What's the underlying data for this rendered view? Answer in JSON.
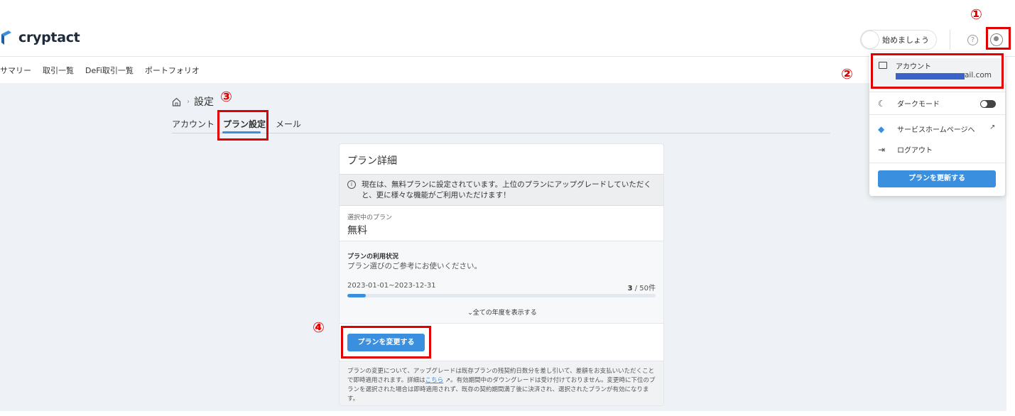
{
  "brand": {
    "name": "cryptact",
    "color": "#3b8fdf"
  },
  "header": {
    "start_label": "始めましょう",
    "help_icon": "question-circle-icon",
    "user_icon": "user-circle-icon"
  },
  "nav": {
    "items": [
      {
        "label": "サマリー"
      },
      {
        "label": "取引一覧"
      },
      {
        "label": "DeFi取引一覧"
      },
      {
        "label": "ポートフォリオ"
      }
    ]
  },
  "breadcrumb": {
    "home_icon": "home-icon",
    "current": "設定"
  },
  "tabs": [
    {
      "label": "アカウント",
      "active": false
    },
    {
      "label": "プラン設定",
      "active": true
    },
    {
      "label": "メール",
      "active": false
    }
  ],
  "plan_card": {
    "title": "プラン詳細",
    "info_text": "現在は、無料プランに設定されています。上位のプランにアップグレードしていただくと、更に様々な機能がご利用いただけます！",
    "selected_label": "選択中のプラン",
    "selected_value": "無料",
    "usage_title": "プランの利用状況",
    "usage_subtitle": "プラン選びのご参考にお使いください。",
    "usage_range": "2023-01-01~2023-12-31",
    "usage_used": "3",
    "usage_limit": " / 50件",
    "usage_fraction": 0.06,
    "show_all": "全ての年度を表示する",
    "change_button": "プランを変更する",
    "note_part1": "プランの変更について、アップグレードは既存プランの残契約日数分を差し引いて、差額をお支払いいただくことで即時適用されます。詳細は",
    "note_link": "こちら",
    "note_part2": "。有効期間中のダウングレードは受け付けておりません。変更時に下位のプランを選択された場合は即時適用されず、既存の契約期間満了後に決済され、選択されたプランが有効になります。"
  },
  "dropdown": {
    "account_label": "アカウント",
    "account_email": "ail.com",
    "dark_mode_label": "ダークモード",
    "dark_mode_on": false,
    "service_home_label": "サービスホームページへ",
    "logout_label": "ログアウト",
    "update_button": "プランを更新する"
  },
  "annotations": {
    "n1": "①",
    "n2": "②",
    "n3": "③",
    "n4": "④",
    "color": "#e00000"
  }
}
